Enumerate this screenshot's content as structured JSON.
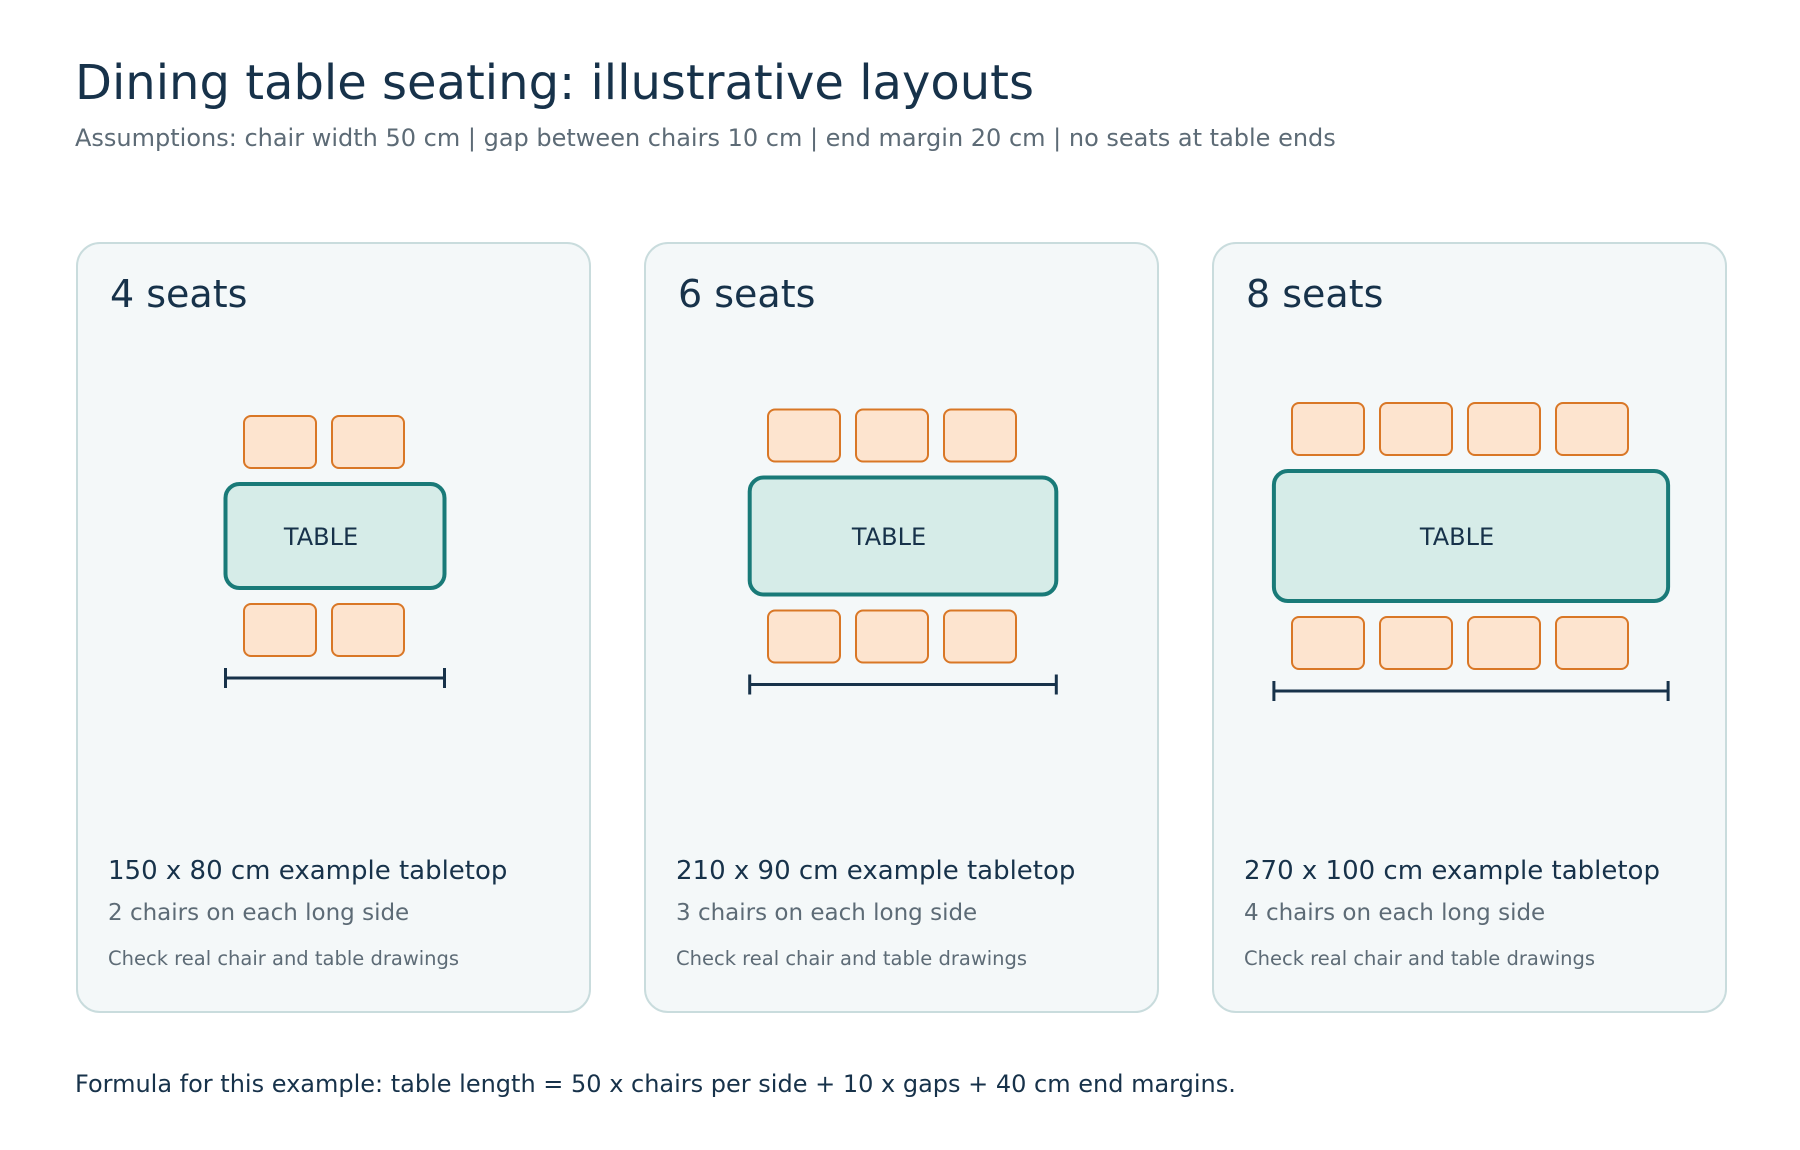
{
  "header": {
    "title": "Dining table seating: illustrative layouts",
    "subtitle": "Assumptions: chair width 50 cm  |  gap between chairs 10 cm  |  end margin 20 cm  |  no seats at table ends"
  },
  "layouts": [
    {
      "title": "4 seats",
      "table_label": "TABLE",
      "chairs_per_side": 2,
      "table_length_cm": 150,
      "table_width_cm": 80,
      "size_text": "150 x 80 cm example tabletop",
      "chairs_text": "2 chairs on each long side",
      "note": "Check real chair and table drawings"
    },
    {
      "title": "6 seats",
      "table_label": "TABLE",
      "chairs_per_side": 3,
      "table_length_cm": 210,
      "table_width_cm": 90,
      "size_text": "210 x 90 cm example tabletop",
      "chairs_text": "3 chairs on each long side",
      "note": "Check real chair and table drawings"
    },
    {
      "title": "8 seats",
      "table_label": "TABLE",
      "chairs_per_side": 4,
      "table_length_cm": 270,
      "table_width_cm": 100,
      "size_text": "270 x 100 cm example tabletop",
      "chairs_text": "4 chairs on each long side",
      "note": "Check real chair and table drawings"
    }
  ],
  "footer": "Formula for this example: table length = 50 x chairs per side + 10 x gaps + 40 cm end margins.",
  "colors": {
    "chair_fill": "#fde4cf",
    "chair_stroke": "#d97726",
    "table_fill": "#d6ece8",
    "table_stroke": "#197a78",
    "text_dark": "#17324a",
    "text_muted": "#5d6b76",
    "card_bg": "#f4f8f9",
    "card_border": "#c9dcdd"
  }
}
